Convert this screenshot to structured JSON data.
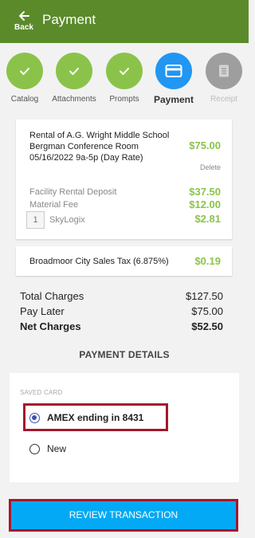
{
  "header": {
    "back_label": "Back",
    "title": "Payment",
    "bar_color": "#5b8a2b"
  },
  "steps": [
    {
      "label": "Catalog",
      "state": "done",
      "icon": "check-icon"
    },
    {
      "label": "Attachments",
      "state": "done",
      "icon": "check-icon"
    },
    {
      "label": "Prompts",
      "state": "done",
      "icon": "check-icon"
    },
    {
      "label": "Payment",
      "state": "active",
      "icon": "credit-card-icon"
    },
    {
      "label": "Receipt",
      "state": "pending",
      "icon": "receipt-icon"
    }
  ],
  "item": {
    "description": "Rental of A.G. Wright Middle School Bergman Conference Room 05/16/2022 9a-5p (Day Rate)",
    "price": "$75.00",
    "delete_label": "Delete",
    "deposit_label": "Facility Rental Deposit",
    "deposit_amount": "$37.50",
    "material_label": "Material Fee",
    "material_amount": "$12.00",
    "skylogix_qty": "1",
    "skylogix_label": "SkyLogix",
    "skylogix_amount": "$2.81"
  },
  "tax": {
    "label": "Broadmoor City Sales Tax (6.875%)",
    "amount": "$0.19"
  },
  "totals": {
    "total_label": "Total Charges",
    "total_value": "$127.50",
    "later_label": "Pay Later",
    "later_value": "$75.00",
    "net_label": "Net Charges",
    "net_value": "$52.50"
  },
  "payment_details": {
    "heading": "PAYMENT DETAILS",
    "saved_label": "SAVED CARD",
    "saved_card": "AMEX ending in 8431",
    "new_label": "New",
    "selected": "saved"
  },
  "review_button": "REVIEW TRANSACTION",
  "colors": {
    "accent_green": "#8bc34a",
    "active_blue": "#2196f3",
    "button_blue": "#03a9f4",
    "highlight_red": "#a3182d"
  }
}
